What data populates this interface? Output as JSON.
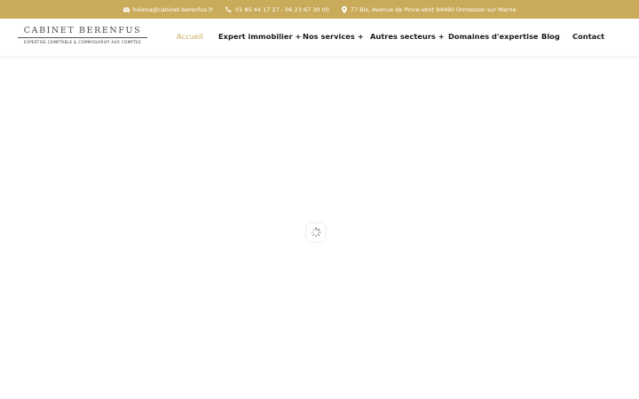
{
  "topbar": {
    "email": "helena@cabinet-berenfus.fr",
    "phone": "01 85 44 17 27 - 06 23 67 30 00",
    "address": "77 Bis, Avenue de Pince-Vent 94490 Ormesson sur Marne",
    "icons": [
      "envelope-icon",
      "phone-icon",
      "map-pin-icon"
    ],
    "background_color": "#c9ab5b"
  },
  "logo": {
    "name": "CABINET BERENFUS",
    "tagline": "EXPERTISE COMPTABLE & COMMISSARIAT AUX COMPTES"
  },
  "nav": {
    "items": [
      {
        "label": "Accueil",
        "active": true
      },
      {
        "label": "Expert immobilier +"
      },
      {
        "label": "Nos services +"
      },
      {
        "label": "Autres secteurs +"
      },
      {
        "label": "Domaines d'expertise"
      },
      {
        "label": "Blog"
      },
      {
        "label": "Contact"
      }
    ],
    "active_color": "#c9ab5b"
  },
  "loader": {
    "icon": "spinner-icon"
  }
}
